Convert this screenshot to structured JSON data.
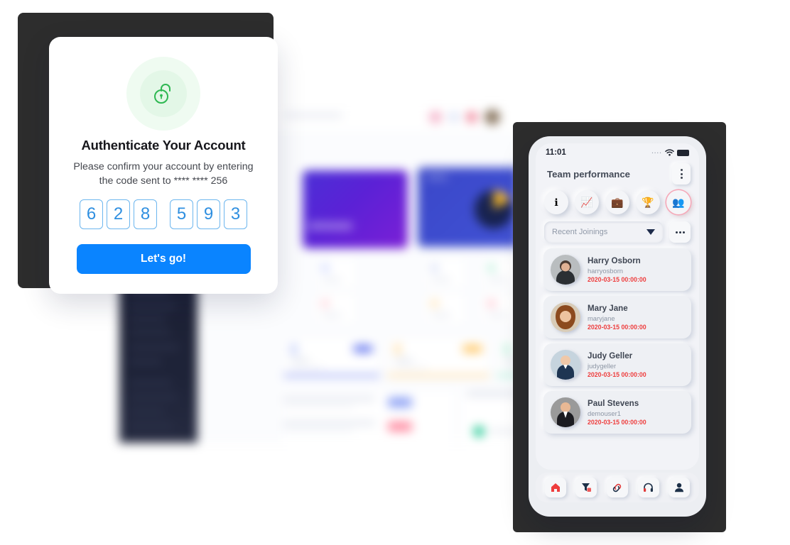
{
  "auth_dialog": {
    "icon": "unlock-icon",
    "title": "Authenticate Your Account",
    "subtitle_line1": "Please confirm your account by entering",
    "subtitle_line2": "the code sent to **** **** 256",
    "otp_digits": [
      "6",
      "2",
      "8",
      "5",
      "9",
      "3"
    ],
    "submit_label": "Let's go!",
    "colors": {
      "accent": "#0a84ff",
      "otp_border": "#6cb6ee",
      "otp_text": "#2f8fe0",
      "lock": "#2eb852"
    }
  },
  "phone": {
    "status_bar": {
      "time": "11:01",
      "signal": "signal-icon",
      "wifi": "wifi-icon",
      "battery": "battery-icon"
    },
    "header": {
      "title": "Team performance",
      "menu": "kebab-menu-icon"
    },
    "quick_icons": [
      {
        "name": "info-icon",
        "glyph": "ℹ",
        "active": false
      },
      {
        "name": "chart-icon",
        "glyph": "📈",
        "active": false
      },
      {
        "name": "briefcase-icon",
        "glyph": "💼",
        "active": false
      },
      {
        "name": "trophy-icon",
        "glyph": "🏆",
        "active": false
      },
      {
        "name": "team-icon",
        "glyph": "👥",
        "active": true
      }
    ],
    "filter": {
      "selected": "Recent Joinings",
      "caret": "chevron-down-icon",
      "more": "more-options-icon"
    },
    "people": [
      {
        "name": "Harry Osborn",
        "handle": "harryosborn",
        "date": "2020-03-15 00:00:00"
      },
      {
        "name": "Mary Jane",
        "handle": "maryjane",
        "date": "2020-03-15 00:00:00"
      },
      {
        "name": "Judy Geller",
        "handle": "judygeller",
        "date": "2020-03-15 00:00:00"
      },
      {
        "name": "Paul Stevens",
        "handle": "demouser1",
        "date": "2020-03-15 00:00:00"
      }
    ],
    "tabs": [
      {
        "name": "home-icon",
        "glyph": "🏠"
      },
      {
        "name": "filter-icon",
        "glyph": "▼"
      },
      {
        "name": "link-icon",
        "glyph": "🔗"
      },
      {
        "name": "headset-icon",
        "glyph": "🎧"
      },
      {
        "name": "profile-icon",
        "glyph": "👤"
      }
    ],
    "colors": {
      "accent_red": "#ee3d3d",
      "active_ring": "#f6a8b8",
      "surface": "#f2f3f7"
    }
  },
  "background_dashboard": {
    "state": "blurred",
    "colors": {
      "sidebar": "#1e2338",
      "hero_purple": "#5b21d6",
      "hero_blue": "#3f4fd1",
      "donut_accent": "#f0b429"
    }
  }
}
